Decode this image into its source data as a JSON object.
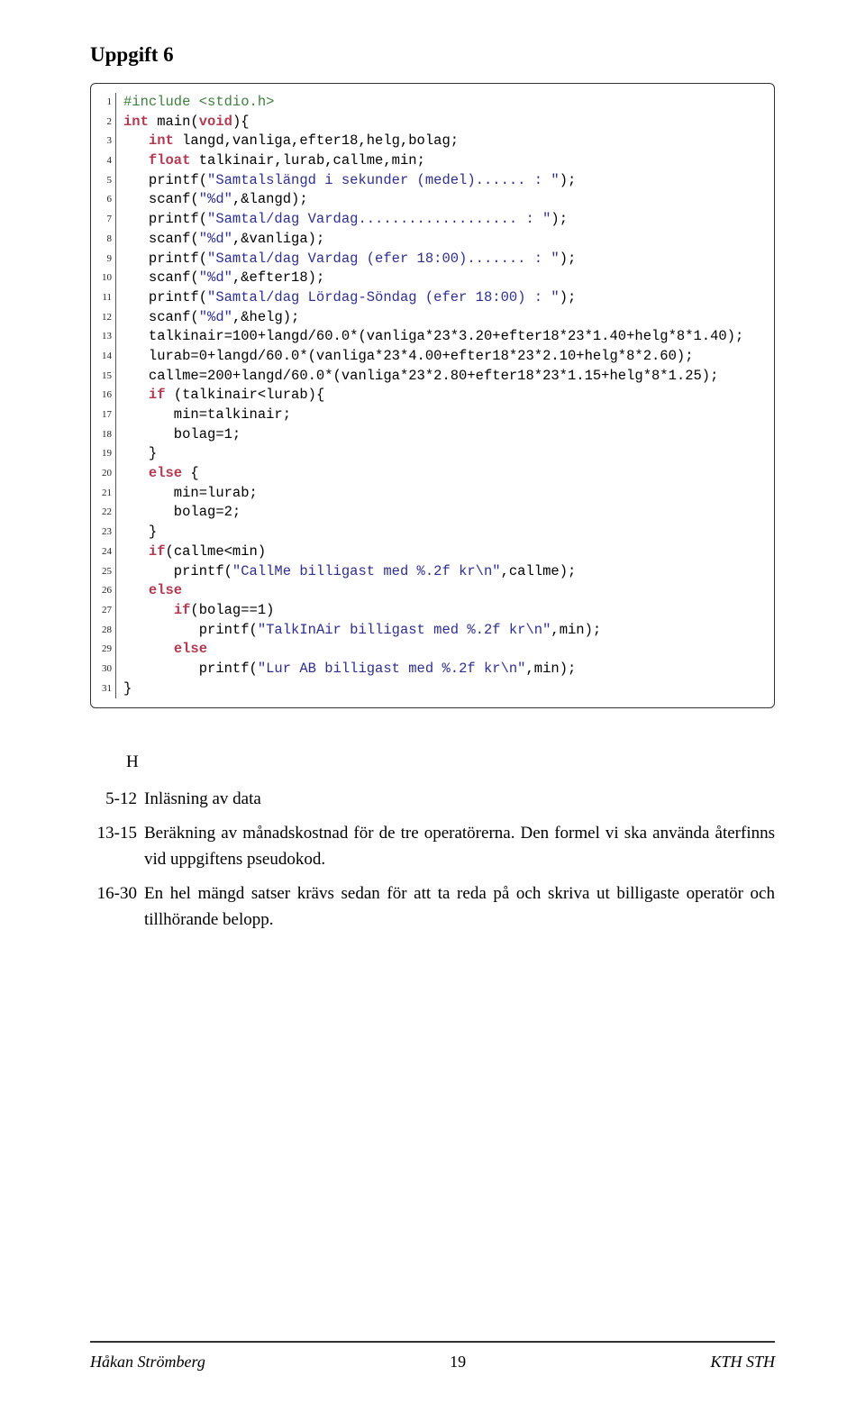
{
  "heading": "Uppgift 6",
  "h_mark": "H",
  "notes": [
    {
      "label": "5-12",
      "text": "Inläsning av data"
    },
    {
      "label": "13-15",
      "text": "Beräkning av månadskostnad för de tre operatörerna. Den formel vi ska använda återfinns vid uppgiftens pseudokod."
    },
    {
      "label": "16-30",
      "text": "En hel mängd satser krävs sedan för att ta reda på och skriva ut billigaste operatör och tillhörande belopp."
    }
  ],
  "footer": {
    "left": "Håkan Strömberg",
    "center": "19",
    "right": "KTH STH"
  },
  "code": [
    {
      "n": "1",
      "seg": [
        {
          "c": "pp",
          "t": "#include <stdio.h>"
        }
      ]
    },
    {
      "n": "2",
      "seg": [
        {
          "c": "kw",
          "t": "int"
        },
        {
          "c": "",
          "t": " main("
        },
        {
          "c": "kw",
          "t": "void"
        },
        {
          "c": "",
          "t": "){"
        }
      ]
    },
    {
      "n": "3",
      "seg": [
        {
          "c": "",
          "t": "   "
        },
        {
          "c": "kw",
          "t": "int"
        },
        {
          "c": "",
          "t": " langd,vanliga,efter18,helg,bolag;"
        }
      ]
    },
    {
      "n": "4",
      "seg": [
        {
          "c": "",
          "t": "   "
        },
        {
          "c": "kw",
          "t": "float"
        },
        {
          "c": "",
          "t": " talkinair,lurab,callme,min;"
        }
      ]
    },
    {
      "n": "5",
      "seg": [
        {
          "c": "",
          "t": "   printf("
        },
        {
          "c": "str",
          "t": "\"Samtalslängd i sekunder (medel)...... : \""
        },
        {
          "c": "",
          "t": ");"
        }
      ]
    },
    {
      "n": "6",
      "seg": [
        {
          "c": "",
          "t": "   scanf("
        },
        {
          "c": "str",
          "t": "\"%d\""
        },
        {
          "c": "",
          "t": ",&langd);"
        }
      ]
    },
    {
      "n": "7",
      "seg": [
        {
          "c": "",
          "t": "   printf("
        },
        {
          "c": "str",
          "t": "\"Samtal/dag Vardag................... : \""
        },
        {
          "c": "",
          "t": ");"
        }
      ]
    },
    {
      "n": "8",
      "seg": [
        {
          "c": "",
          "t": "   scanf("
        },
        {
          "c": "str",
          "t": "\"%d\""
        },
        {
          "c": "",
          "t": ",&vanliga);"
        }
      ]
    },
    {
      "n": "9",
      "seg": [
        {
          "c": "",
          "t": "   printf("
        },
        {
          "c": "str",
          "t": "\"Samtal/dag Vardag (efer 18:00)....... : \""
        },
        {
          "c": "",
          "t": ");"
        }
      ]
    },
    {
      "n": "10",
      "seg": [
        {
          "c": "",
          "t": "   scanf("
        },
        {
          "c": "str",
          "t": "\"%d\""
        },
        {
          "c": "",
          "t": ",&efter18);"
        }
      ]
    },
    {
      "n": "11",
      "seg": [
        {
          "c": "",
          "t": "   printf("
        },
        {
          "c": "str",
          "t": "\"Samtal/dag Lördag-Söndag (efer 18:00) : \""
        },
        {
          "c": "",
          "t": ");"
        }
      ]
    },
    {
      "n": "12",
      "seg": [
        {
          "c": "",
          "t": "   scanf("
        },
        {
          "c": "str",
          "t": "\"%d\""
        },
        {
          "c": "",
          "t": ",&helg);"
        }
      ]
    },
    {
      "n": "13",
      "seg": [
        {
          "c": "",
          "t": "   talkinair=100+langd/60.0*(vanliga*23*3.20+efter18*23*1.40+helg*8*1.40);"
        }
      ]
    },
    {
      "n": "14",
      "seg": [
        {
          "c": "",
          "t": "   lurab=0+langd/60.0*(vanliga*23*4.00+efter18*23*2.10+helg*8*2.60);"
        }
      ]
    },
    {
      "n": "15",
      "seg": [
        {
          "c": "",
          "t": "   callme=200+langd/60.0*(vanliga*23*2.80+efter18*23*1.15+helg*8*1.25);"
        }
      ]
    },
    {
      "n": "16",
      "seg": [
        {
          "c": "",
          "t": "   "
        },
        {
          "c": "kw",
          "t": "if"
        },
        {
          "c": "",
          "t": " (talkinair<lurab){"
        }
      ]
    },
    {
      "n": "17",
      "seg": [
        {
          "c": "",
          "t": "      min=talkinair;"
        }
      ]
    },
    {
      "n": "18",
      "seg": [
        {
          "c": "",
          "t": "      bolag=1;"
        }
      ]
    },
    {
      "n": "19",
      "seg": [
        {
          "c": "",
          "t": "   }"
        }
      ]
    },
    {
      "n": "20",
      "seg": [
        {
          "c": "",
          "t": "   "
        },
        {
          "c": "kw",
          "t": "else"
        },
        {
          "c": "",
          "t": " {"
        }
      ]
    },
    {
      "n": "21",
      "seg": [
        {
          "c": "",
          "t": "      min=lurab;"
        }
      ]
    },
    {
      "n": "22",
      "seg": [
        {
          "c": "",
          "t": "      bolag=2;"
        }
      ]
    },
    {
      "n": "23",
      "seg": [
        {
          "c": "",
          "t": "   }"
        }
      ]
    },
    {
      "n": "24",
      "seg": [
        {
          "c": "",
          "t": "   "
        },
        {
          "c": "kw",
          "t": "if"
        },
        {
          "c": "",
          "t": "(callme<min)"
        }
      ]
    },
    {
      "n": "25",
      "seg": [
        {
          "c": "",
          "t": "      printf("
        },
        {
          "c": "str",
          "t": "\"CallMe billigast med %.2f kr\\n\""
        },
        {
          "c": "",
          "t": ",callme);"
        }
      ]
    },
    {
      "n": "26",
      "seg": [
        {
          "c": "",
          "t": "   "
        },
        {
          "c": "kw",
          "t": "else"
        }
      ]
    },
    {
      "n": "27",
      "seg": [
        {
          "c": "",
          "t": "      "
        },
        {
          "c": "kw",
          "t": "if"
        },
        {
          "c": "",
          "t": "(bolag==1)"
        }
      ]
    },
    {
      "n": "28",
      "seg": [
        {
          "c": "",
          "t": "         printf("
        },
        {
          "c": "str",
          "t": "\"TalkInAir billigast med %.2f kr\\n\""
        },
        {
          "c": "",
          "t": ",min);"
        }
      ]
    },
    {
      "n": "29",
      "seg": [
        {
          "c": "",
          "t": "      "
        },
        {
          "c": "kw",
          "t": "else"
        }
      ]
    },
    {
      "n": "30",
      "seg": [
        {
          "c": "",
          "t": "         printf("
        },
        {
          "c": "str",
          "t": "\"Lur AB billigast med %.2f kr\\n\""
        },
        {
          "c": "",
          "t": ",min);"
        }
      ]
    },
    {
      "n": "31",
      "seg": [
        {
          "c": "",
          "t": "}"
        }
      ]
    }
  ]
}
